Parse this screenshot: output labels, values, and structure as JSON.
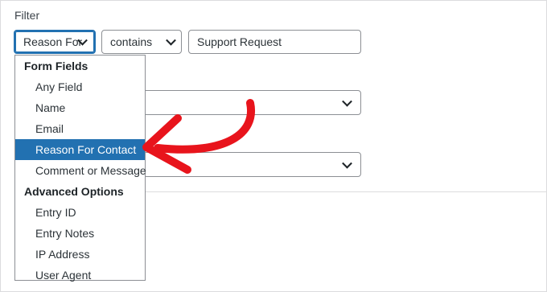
{
  "filter": {
    "label": "Filter",
    "field_select_value": "Reason For",
    "operator_select_value": "contains",
    "value_input": "Support Request"
  },
  "dropdown": {
    "groups": [
      {
        "label": "Form Fields",
        "options": [
          "Any Field",
          "Name",
          "Email",
          "Reason For Contact",
          "Comment or Message"
        ]
      },
      {
        "label": "Advanced Options",
        "options": [
          "Entry ID",
          "Entry Notes",
          "IP Address",
          "User Agent"
        ]
      }
    ],
    "selected_option": "Reason For Contact"
  },
  "colors": {
    "accent": "#2271b1",
    "annotation_arrow": "#e8141c"
  }
}
